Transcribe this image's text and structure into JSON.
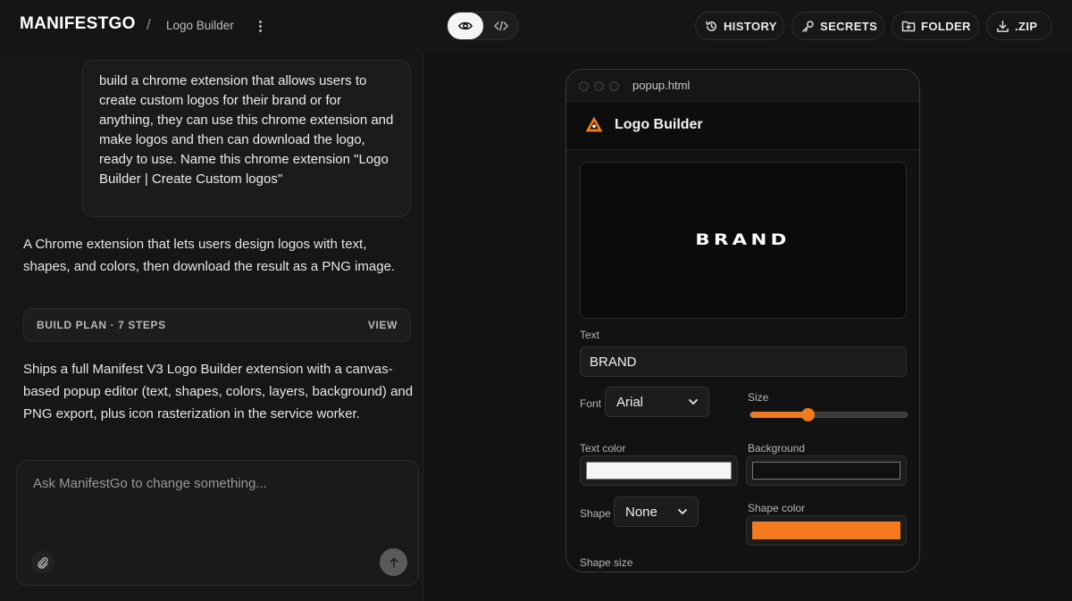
{
  "header": {
    "brand": "MANIFESTGO",
    "separator": "/",
    "project_name": "Logo Builder",
    "buttons": {
      "history": "HISTORY",
      "secrets": "SECRETS",
      "folder": "FOLDER",
      "zip": ".ZIP"
    }
  },
  "chat": {
    "user_message": "build a chrome extension that allows users to create custom logos for their brand or for anything, they can use this chrome extension and make logos and then can download the logo, ready to use. Name this chrome extension \"Logo Builder | Create Custom logos\"",
    "assistant_summary": "A Chrome extension that lets users design logos with text, shapes, and colors, then download the result as a PNG image.",
    "build_plan": {
      "label": "BUILD PLAN · 7 STEPS",
      "action": "VIEW"
    },
    "assistant_result": "Ships a full Manifest V3 Logo Builder extension with a canvas-based popup editor (text, shapes, colors, layers, background) and PNG export, plus icon rasterization in the service worker.",
    "composer_placeholder": "Ask ManifestGo to change something..."
  },
  "preview": {
    "file_name": "popup.html",
    "app_title": "Logo Builder",
    "canvas_text": "BRAND",
    "text_label": "Text",
    "text_value": "BRAND",
    "font_label": "Font",
    "font_value": "Arial",
    "size_label": "Size",
    "size_fraction": 0.36,
    "text_color_label": "Text color",
    "text_color": "#f5f5f5",
    "background_label": "Background",
    "background_color": "#111111",
    "shape_label": "Shape",
    "shape_value": "None",
    "shape_color_label": "Shape color",
    "shape_color": "#f47a1f",
    "shape_size_label": "Shape size"
  },
  "colors": {
    "accent": "#f07a1e",
    "background": "#141414"
  }
}
